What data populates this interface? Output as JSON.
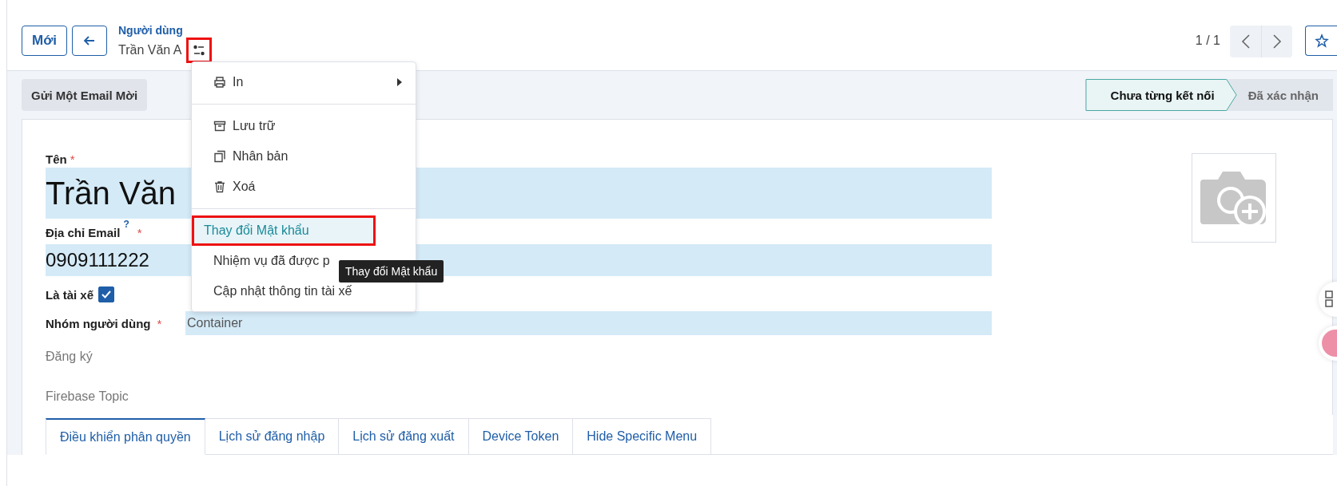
{
  "header": {
    "new_button": "Mới",
    "breadcrumb": "Người dùng",
    "record_name": "Trần Văn A",
    "actions_highlighted": true,
    "pager": "1 / 1"
  },
  "action_button": "Gửi Một Email Mời",
  "status_steps": [
    {
      "label": "Chưa từng kết nối",
      "selected": true
    },
    {
      "label": "Đã xác nhận",
      "selected": false
    }
  ],
  "form": {
    "required_mark": "*",
    "fields": [
      {
        "kind": "title",
        "label": "Tên",
        "required": true,
        "value": "Trần Văn"
      },
      {
        "kind": "large",
        "label": "Địa chỉ Email",
        "help": "?",
        "required": true,
        "value": "0909111222"
      },
      {
        "kind": "checkbox",
        "label": "Là tài xế",
        "checked": true
      },
      {
        "kind": "inline",
        "label": "Nhóm người dùng",
        "required": true,
        "value": "Container"
      },
      {
        "kind": "empty",
        "label": "Đăng ký"
      },
      {
        "kind": "empty",
        "label": "Firebase Topic"
      }
    ]
  },
  "tabs": [
    {
      "label": "Điều khiển phân quyền",
      "selected": true
    },
    {
      "label": "Lịch sử đăng nhập",
      "selected": false
    },
    {
      "label": "Lịch sử đăng xuất",
      "selected": false
    },
    {
      "label": "Device Token",
      "selected": false
    },
    {
      "label": "Hide Specific Menu",
      "selected": false
    }
  ],
  "menu": {
    "sections": [
      [
        {
          "kind": "print",
          "label": "In",
          "submenu": true,
          "hovered": false,
          "highlighted": false
        }
      ],
      [
        {
          "kind": "archive",
          "label": "Lưu trữ",
          "submenu": false,
          "hovered": false,
          "highlighted": false
        },
        {
          "kind": "copy",
          "label": "Nhân bản",
          "submenu": false,
          "hovered": false,
          "highlighted": false
        },
        {
          "kind": "trash",
          "label": "Xoá",
          "submenu": false,
          "hovered": false,
          "highlighted": false
        }
      ],
      [
        {
          "kind": "plain",
          "label": "Thay đổi Mật khẩu",
          "submenu": false,
          "hovered": true,
          "highlighted": true
        },
        {
          "kind": "plain",
          "label": "Nhiệm vụ đã được p",
          "submenu": false,
          "hovered": false,
          "highlighted": false
        },
        {
          "kind": "plain",
          "label": "Cập nhật thông tin tài xế",
          "submenu": false,
          "hovered": false,
          "highlighted": false
        }
      ]
    ]
  },
  "tooltip": "Thay đổi Mật khẩu"
}
